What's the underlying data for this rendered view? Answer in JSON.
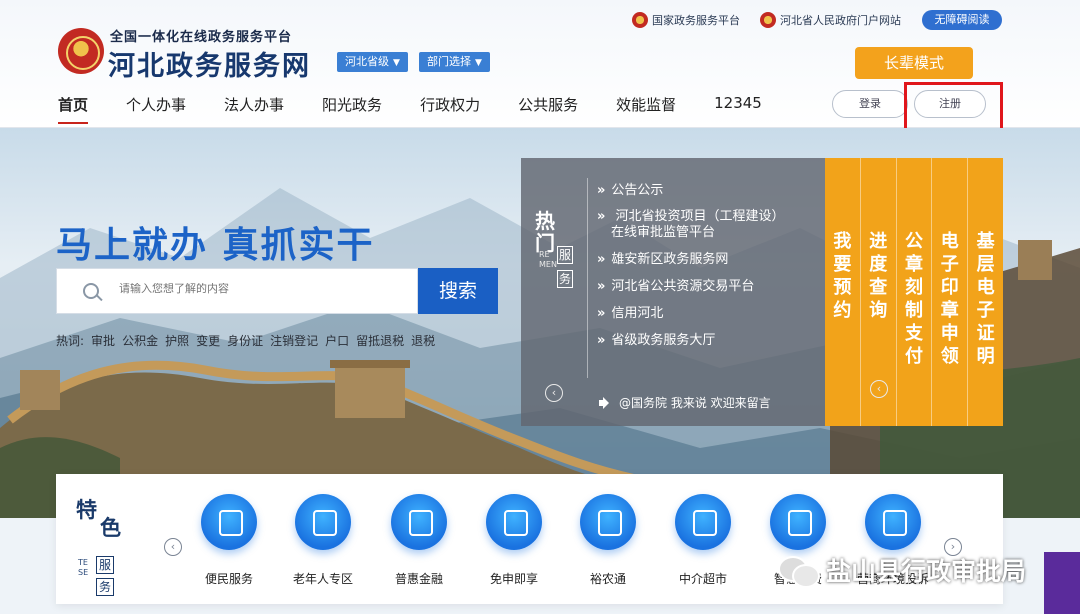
{
  "header": {
    "brand_sub": "全国一体化在线政务服务平台",
    "brand_main": "河北政务服务网",
    "region_select": "河北省级",
    "dept_select": "部门选择",
    "top_links": [
      "国家政务服务平台",
      "河北省人民政府门户网站"
    ],
    "accessibility": "无障碍阅读",
    "elder_mode": "长辈模式",
    "login": "登录",
    "register": "注册"
  },
  "nav": [
    "首页",
    "个人办事",
    "法人办事",
    "阳光政务",
    "行政权力",
    "公共服务",
    "效能监督",
    "12345"
  ],
  "hero": {
    "slogan": "马上就办 真抓实干",
    "search_placeholder": "请输入您想了解的内容",
    "search_button": "搜索",
    "hotwords_label": "热词:",
    "hotwords": [
      "审批",
      "公积金",
      "护照",
      "变更",
      "身份证",
      "注销登记",
      "户口",
      "留抵退税",
      "退税"
    ]
  },
  "hot_panel": {
    "title": "热门",
    "title_en": "RE MEN",
    "sub": [
      "服",
      "务"
    ],
    "items": [
      "公告公示",
      "河北省投资项目（工程建设）",
      "在线审批监管平台",
      "雄安新区政务服务网",
      "河北省公共资源交易平台",
      "信用河北",
      "省级政务服务大厅"
    ],
    "ticker": "@国务院 我来说 欢迎来留言"
  },
  "quick_actions": [
    "我要预约",
    "进度查询",
    "公章刻制支付",
    "电子印章申领",
    "基层电子证明"
  ],
  "features": {
    "title_a": "特",
    "title_b": "色",
    "title_en": "TE SE",
    "sub": [
      "服",
      "务"
    ],
    "items": [
      {
        "label": "便民服务",
        "icon": "people-service-icon"
      },
      {
        "label": "老年人专区",
        "icon": "elderly-icon"
      },
      {
        "label": "普惠金融",
        "icon": "coins-icon"
      },
      {
        "label": "免申即享",
        "icon": "certificate-icon"
      },
      {
        "label": "裕农通",
        "icon": "wheat-icon"
      },
      {
        "label": "中介超市",
        "icon": "agency-icon"
      },
      {
        "label": "智慧缴费",
        "icon": "payment-icon"
      },
      {
        "label": "营商环境投诉",
        "icon": "complaint-mail-icon"
      }
    ]
  },
  "watermark": "盐山县行政审批局",
  "colors": {
    "brand_blue": "#1a5fc4",
    "accent_orange": "#f2a31a",
    "highlight_red": "#e0161c"
  }
}
